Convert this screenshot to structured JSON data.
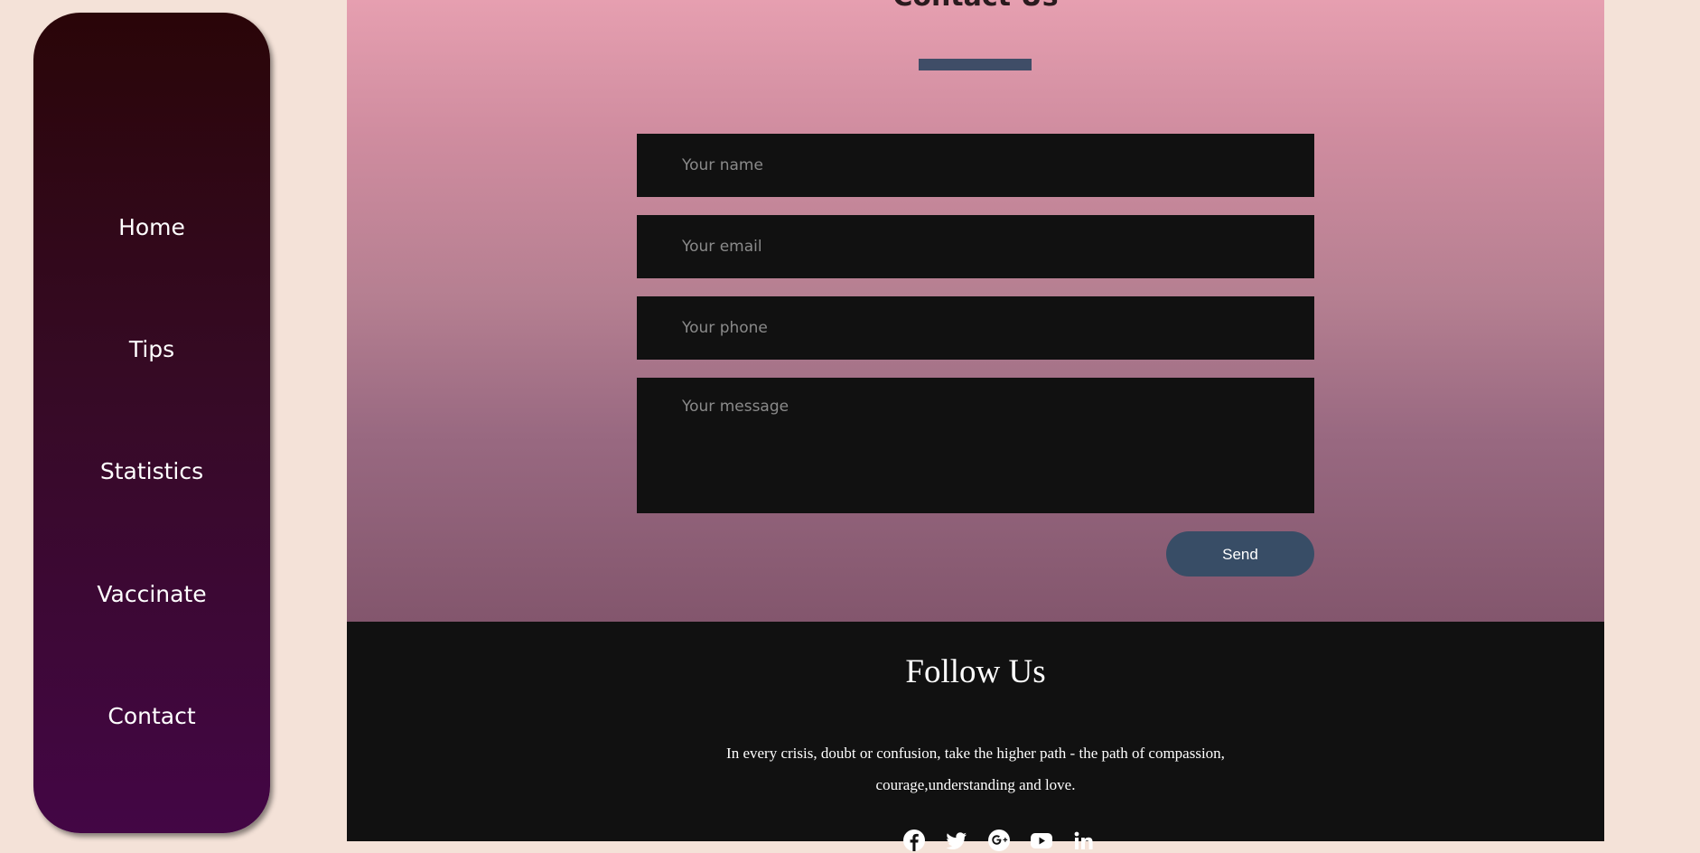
{
  "sidebar": {
    "items": [
      {
        "label": "Home"
      },
      {
        "label": "Tips"
      },
      {
        "label": "Statistics"
      },
      {
        "label": "Vaccinate"
      },
      {
        "label": "Contact"
      }
    ]
  },
  "contact": {
    "title": "Contact Us",
    "name_placeholder": "Your name",
    "email_placeholder": "Your email",
    "phone_placeholder": "Your phone",
    "message_placeholder": "Your message",
    "send_label": "Send"
  },
  "footer": {
    "title": "Follow Us",
    "quote_line1": "In every crisis, doubt or confusion, take the higher path - the path of compassion,",
    "quote_line2": "courage,understanding and love.",
    "social_icons": [
      "facebook-icon",
      "twitter-icon",
      "google-plus-icon",
      "youtube-icon",
      "linkedin-icon"
    ]
  },
  "colors": {
    "page_background": "#f4e2d8",
    "sidebar_top": "#2a0508",
    "sidebar_bottom": "#430645",
    "accent": "#384d66",
    "field_background": "#111111",
    "footer_background": "#111111"
  }
}
